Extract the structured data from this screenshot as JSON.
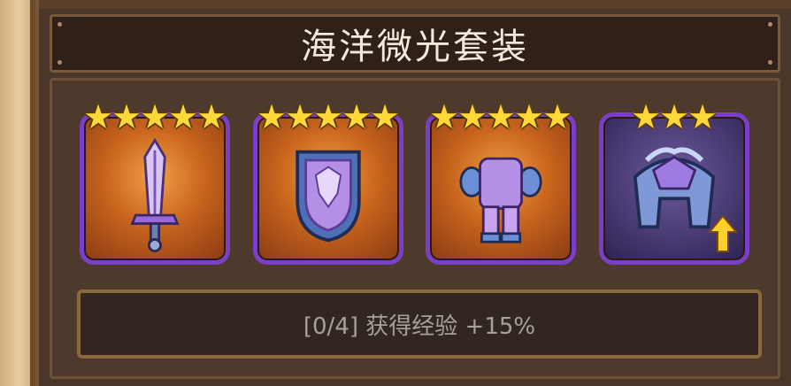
{
  "set": {
    "title": "海洋微光套装",
    "bonus_text": "[0/4] 获得经验 +15%"
  },
  "items": [
    {
      "name": "sword",
      "stars": 5
    },
    {
      "name": "shield",
      "stars": 5
    },
    {
      "name": "armor",
      "stars": 5
    },
    {
      "name": "helmet",
      "stars": 3,
      "upgrade_available": true
    }
  ],
  "colors": {
    "slot_border": "#7a3ec8",
    "star": "#ffd83a",
    "upgrade_arrow": "#ffd02a"
  }
}
